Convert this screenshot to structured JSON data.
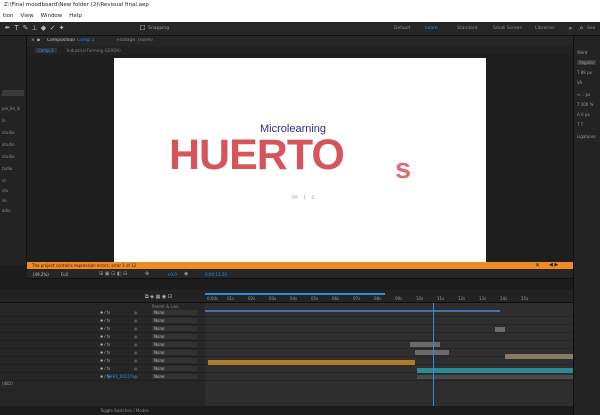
{
  "window": {
    "title": "Z:\\Final moodboard\\New folder (2)\\Revisual final.aep",
    "menu": [
      "tion",
      "View",
      "Window",
      "Help"
    ]
  },
  "toolbar": {
    "snapping_label": "Snapping",
    "workspaces": [
      "Default",
      "Learn",
      "Standard",
      "Small Screen",
      "Libraries"
    ],
    "active_workspace": "Learn",
    "search_placeholder": "Sea"
  },
  "left_panel": {
    "items": [
      "ple_lle_lo",
      "lo",
      "xtudio",
      "xtudio",
      "xtudio",
      "tudio",
      "xt",
      "xtu",
      "ile",
      "adio"
    ]
  },
  "composition": {
    "panel_tab": "Composition",
    "comp_name": "Comp 1",
    "footage_tab": "Footage: (none)",
    "view_tabs": [
      "Comp 1",
      "Industrial Farming (LEADA)"
    ],
    "canvas": {
      "subtitle": "Microlearning",
      "title_main": "HUERTO",
      "title_suffix": "s",
      "tagline": "m i c"
    },
    "warning": "The project contains expression errors: error 1 of 12",
    "footer": {
      "zoom": "(49.2%)",
      "resolution": "Full",
      "exposure": "+0.0",
      "timecode": "0:00:13:20"
    }
  },
  "timeline": {
    "ruler_labels": [
      "0:00s",
      "01s",
      "02s",
      "03s",
      "04s",
      "05s",
      "06s",
      "07s",
      "08s",
      "09s",
      "10s",
      "11s",
      "12s",
      "13s",
      "14s",
      "15s"
    ],
    "parent_header": "Parent & Link",
    "rows": [
      {
        "parent": "None"
      },
      {
        "parent": "None"
      },
      {
        "parent": "None"
      },
      {
        "parent": "None"
      },
      {
        "parent": "None"
      },
      {
        "parent": "None"
      },
      {
        "parent": "None"
      },
      {
        "parent": "None"
      },
      {
        "parent": "None"
      }
    ],
    "highlighted_layer": "[HEX_001].fx",
    "footer_label": "Toggle Switches / Modes",
    "bottom_label": "(482)"
  },
  "right_panel": {
    "items": [
      "Word",
      "Regular",
      "T 89 px",
      "VA",
      "≡ .. px",
      "T 100 %",
      "A 0 px",
      "T T",
      "Ligatures"
    ]
  },
  "colors": {
    "title_red": "#d5555b",
    "subtitle_blue": "#2e2e78",
    "accent": "#2d8ceb",
    "warning": "#f08a24",
    "bar_orange": "#b07a2a",
    "bar_teal": "#2a8b92",
    "bar_gray": "#6b6b6b",
    "bar_tan": "#8b7a63"
  }
}
